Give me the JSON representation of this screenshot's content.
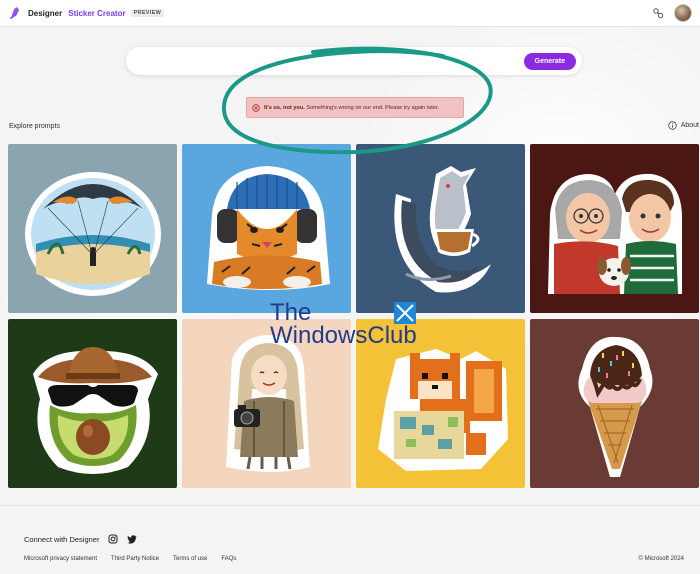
{
  "header": {
    "brand": "Designer",
    "product": "Sticker Creator",
    "badge": "PREVIEW"
  },
  "prompt": {
    "placeholder": "",
    "value": "",
    "generate_label": "Generate"
  },
  "error": {
    "bold_text": "It's us, not you.",
    "rest_text": " Something's wrong on our end. Please try again later."
  },
  "explore": {
    "label": "Explore prompts",
    "about_label": "About"
  },
  "tiles": [
    {
      "name": "parachute-beach-sticker",
      "bg": "#8aa5b0"
    },
    {
      "name": "tiger-headphones-sticker",
      "bg": "#5aa6de"
    },
    {
      "name": "dragon-teacup-sticker",
      "bg": "#3b5878"
    },
    {
      "name": "grandma-boy-dog-sticker",
      "bg": "#4a1712"
    },
    {
      "name": "avocado-cowboy-sticker",
      "bg": "#1e3a16"
    },
    {
      "name": "girl-camera-sticker",
      "bg": "#f4d5bd"
    },
    {
      "name": "pixel-squirrel-map-sticker",
      "bg": "#f4c236"
    },
    {
      "name": "ice-cream-cone-sticker",
      "bg": "#6a3b34"
    }
  ],
  "watermark": {
    "line1": "The",
    "line2": "WindowsClub"
  },
  "footer": {
    "connect_label": "Connect with Designer",
    "links": [
      "Microsoft privacy statement",
      "Third Party Notice",
      "Terms of use",
      "FAQs"
    ],
    "copyright": "© Microsoft 2024"
  },
  "colors": {
    "accent": "#8a2be2",
    "error_bg": "#f2c2c2",
    "annotation": "#1a9a86"
  }
}
